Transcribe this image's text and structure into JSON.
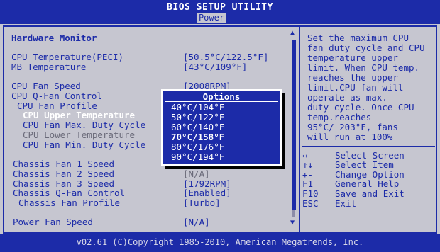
{
  "header": {
    "title": "BIOS SETUP UTILITY",
    "tab": "Power"
  },
  "menu": {
    "section_title": "Hardware Monitor",
    "items": [
      {
        "label": "CPU Temperature(PECI)",
        "value": "[50.5°C/122.5°F]"
      },
      {
        "label": "MB Temperature",
        "value": "[43°C/109°F]"
      },
      {
        "label": "CPU Fan Speed",
        "value": "[2008RPM]"
      },
      {
        "label": "CPU Q-Fan Control",
        "value": ""
      },
      {
        "label": "CPU Fan Profile",
        "value": ""
      },
      {
        "label": "CPU Upper Temperature",
        "value": ""
      },
      {
        "label": "CPU Fan Max. Duty Cycle",
        "value": ""
      },
      {
        "label": "CPU Lower Temperature",
        "value": ""
      },
      {
        "label": "CPU Fan Min. Duty Cycle",
        "value": ""
      },
      {
        "label": "Chassis Fan 1 Speed",
        "value": ""
      },
      {
        "label": "Chassis Fan 2 Speed",
        "value": "[N/A]"
      },
      {
        "label": "Chassis Fan 3 Speed",
        "value": "[1792RPM]"
      },
      {
        "label": "Chassis Q-Fan Control",
        "value": "[Enabled]"
      },
      {
        "label": "Chassis Fan Profile",
        "value": "[Turbo]"
      },
      {
        "label": "Power Fan Speed",
        "value": "[N/A]"
      }
    ]
  },
  "popup": {
    "title": "Options",
    "options": [
      "40°C/104°F",
      "50°C/122°F",
      "60°C/140°F",
      "70°C/158°F",
      "80°C/176°F",
      "90°C/194°F"
    ],
    "selected_index": 3
  },
  "help": {
    "lines": [
      "Set the maximum CPU",
      "fan duty cycle and CPU",
      "temperature upper",
      "limit. When CPU temp.",
      "reaches the upper",
      "limit.CPU fan will",
      "operate as max.",
      "duty cycle. Once CPU",
      "temp.reaches",
      "95°C/ 203°F, fans",
      "will run at 100%"
    ]
  },
  "keys": [
    {
      "key": "↔",
      "desc": "Select Screen"
    },
    {
      "key": "↑↓",
      "desc": "Select Item"
    },
    {
      "key": "+-",
      "desc": "Change Option"
    },
    {
      "key": "F1",
      "desc": "General Help"
    },
    {
      "key": "F10",
      "desc": "Save and Exit"
    },
    {
      "key": "ESC",
      "desc": "Exit"
    }
  ],
  "footer": {
    "text": "v02.61 (C)Copyright 1985-2010, American Megatrends, Inc."
  },
  "colors": {
    "blue": "#1c2ba8",
    "panel": "#c6c6d0",
    "white": "#ffffff"
  }
}
